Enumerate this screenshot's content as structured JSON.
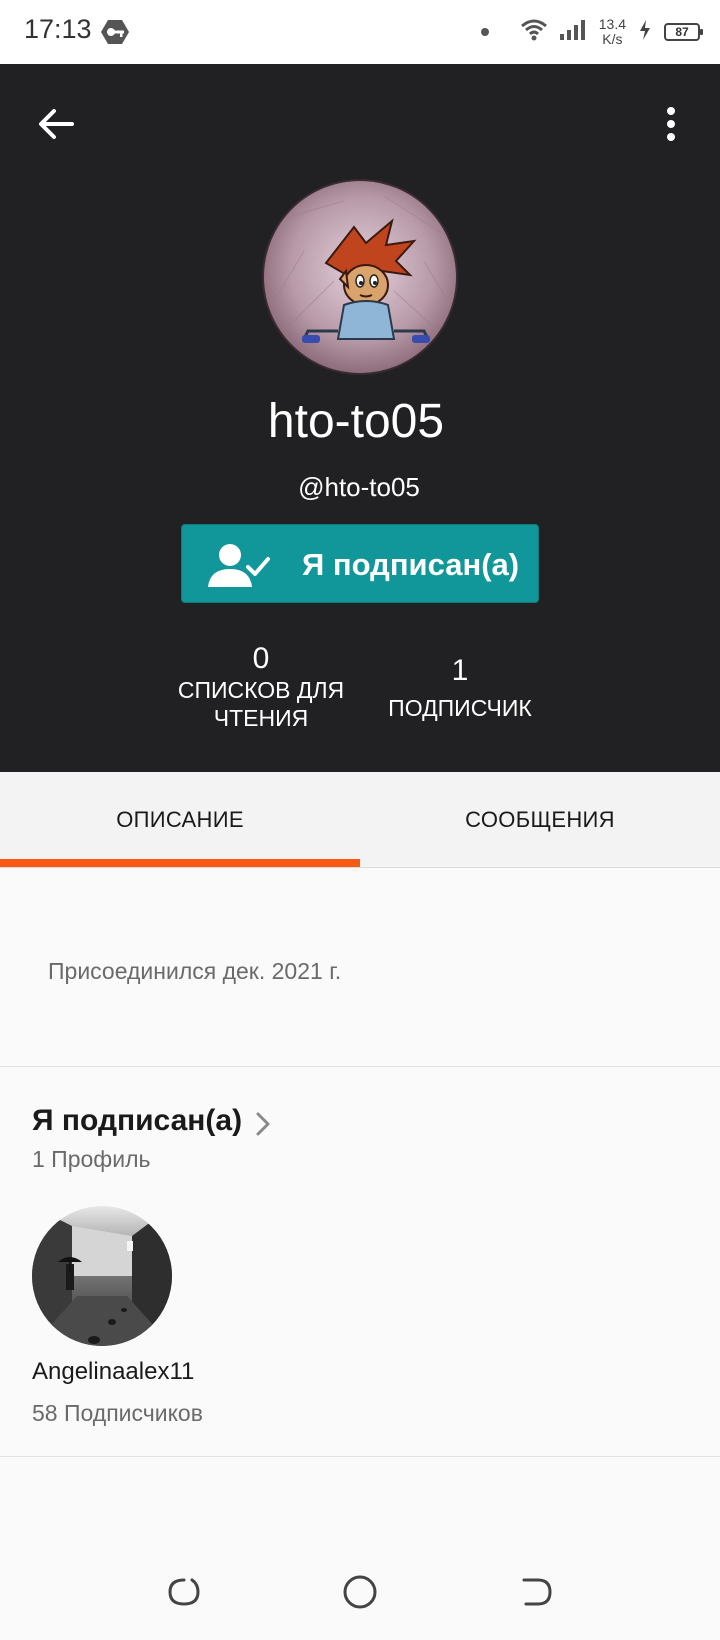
{
  "status_bar": {
    "time": "17:13",
    "net_speed_value": "13.4",
    "net_speed_unit": "K/s",
    "battery": "87",
    "icons": [
      "key-icon",
      "wifi-icon",
      "signal-icon",
      "charging-icon",
      "battery-icon"
    ]
  },
  "header": {
    "display_name": "hto-to05",
    "username": "@hto-to05",
    "follow_button_label": "Я подписан(а)",
    "stats": {
      "reading_lists_value": "0",
      "reading_lists_label_line1": "СПИСКОВ ДЛЯ",
      "reading_lists_label_line2": "ЧТЕНИЯ",
      "followers_value": "1",
      "followers_label": "ПОДПИСЧИК"
    },
    "background_color": "#212022"
  },
  "tabs": [
    {
      "label": "ОПИСАНИЕ",
      "active": true
    },
    {
      "label": "СООБЩЕНИЯ",
      "active": false
    }
  ],
  "about": {
    "joined": "Присоединился дек. 2021 г."
  },
  "following": {
    "title": "Я подписан(а)",
    "count": "1 Профиль",
    "profiles": [
      {
        "name": "Angelinaalex11",
        "followers": "58 Подписчиков"
      }
    ]
  },
  "colors": {
    "accent": "#fa5a14",
    "follow_button": "#11969a"
  }
}
